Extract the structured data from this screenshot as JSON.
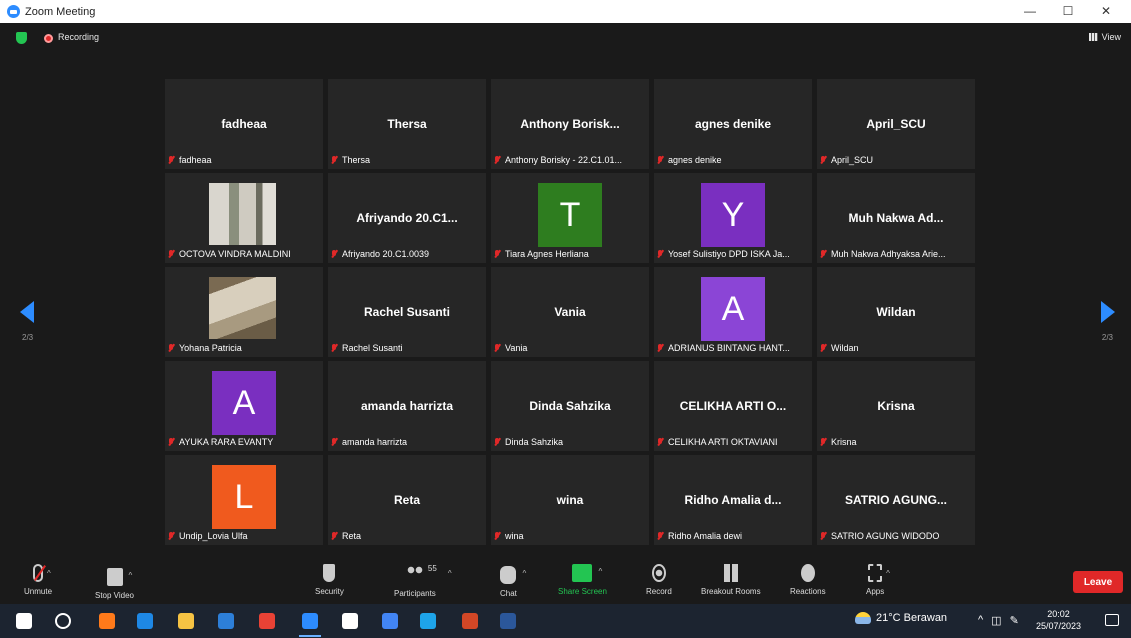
{
  "window": {
    "title": "Zoom Meeting",
    "controls": [
      "—",
      "☐",
      "✕"
    ]
  },
  "topbar": {
    "recording_label": "Recording",
    "view_label": "View"
  },
  "pagination": {
    "left": "2/3",
    "right": "2/3"
  },
  "participants": [
    {
      "tile_name": "fadheaa",
      "label": "fadheaa"
    },
    {
      "tile_name": "Thersa",
      "label": "Thersa"
    },
    {
      "tile_name": "Anthony  Borisk...",
      "label": "Anthony Borisky - 22.C1.01..."
    },
    {
      "tile_name": "agnes denike",
      "label": "agnes denike"
    },
    {
      "tile_name": "April_SCU",
      "label": "April_SCU"
    },
    {
      "tile_name": "",
      "label": "OCTOVA VINDRA MALDINI",
      "photo": "plants"
    },
    {
      "tile_name": "Afriyando 20.C1...",
      "label": "Afriyando 20.C1.0039"
    },
    {
      "tile_name": "",
      "label": "Tiara Agnes Herliana",
      "avatar": "T",
      "avatar_color": "#2e7d1f"
    },
    {
      "tile_name": "",
      "label": "Yosef Sulistiyo DPD ISKA Ja...",
      "avatar": "Y",
      "avatar_color": "#7a2fc0"
    },
    {
      "tile_name": "Muh Nakwa Ad...",
      "label": "Muh Nakwa Adhyaksa Arie..."
    },
    {
      "tile_name": "",
      "label": "Yohana Patricia",
      "photo": "patricia"
    },
    {
      "tile_name": "Rachel Susanti",
      "label": "Rachel Susanti"
    },
    {
      "tile_name": "Vania",
      "label": "Vania"
    },
    {
      "tile_name": "",
      "label": "ADRIANUS BINTANG HANT...",
      "avatar": "A",
      "avatar_color": "#8b45d6"
    },
    {
      "tile_name": "Wildan",
      "label": "Wildan"
    },
    {
      "tile_name": "",
      "label": "AYUKA RARA EVANTY",
      "avatar": "A",
      "avatar_color": "#7a2fc0"
    },
    {
      "tile_name": "amanda harrizta",
      "label": "amanda harrizta"
    },
    {
      "tile_name": "Dinda Sahzika",
      "label": "Dinda Sahzika"
    },
    {
      "tile_name": "CELIKHA ARTI O...",
      "label": "CELIKHA ARTI OKTAVIANI"
    },
    {
      "tile_name": "Krisna",
      "label": "Krisna"
    },
    {
      "tile_name": "",
      "label": "Undip_Lovia Ulfa",
      "avatar": "L",
      "avatar_color": "#f05a1e"
    },
    {
      "tile_name": "Reta",
      "label": "Reta"
    },
    {
      "tile_name": "wina",
      "label": "wina"
    },
    {
      "tile_name": "Ridho Amalia d...",
      "label": "Ridho Amalia dewi"
    },
    {
      "tile_name": "SATRIO AGUNG...",
      "label": "SATRIO AGUNG WIDODO"
    }
  ],
  "toolbar": {
    "unmute": "Unmute",
    "stop_video": "Stop Video",
    "security": "Security",
    "participants": "Participants",
    "participants_count": "55",
    "chat": "Chat",
    "share_screen": "Share Screen",
    "record": "Record",
    "breakout_rooms": "Breakout Rooms",
    "reactions": "Reactions",
    "apps": "Apps",
    "leave": "Leave"
  },
  "taskbar": {
    "weather": "21°C  Berawan",
    "time": "20:02",
    "date": "25/07/2023",
    "icons": [
      "windows-start-icon",
      "search-icon",
      "firefox-icon",
      "edge-icon",
      "file-explorer-icon",
      "mail-icon",
      "chrome-icon",
      "zoom-icon",
      "store-icon",
      "chrome-alt-icon",
      "photos-icon",
      "powerpoint-icon",
      "word-icon"
    ],
    "tray_icons": [
      "tray-chevron-icon",
      "network-icon",
      "pen-icon"
    ]
  },
  "colors": {
    "accent": "#2d8cff",
    "leave": "#e02828",
    "share": "#23c552",
    "tile_bg": "#262626"
  }
}
